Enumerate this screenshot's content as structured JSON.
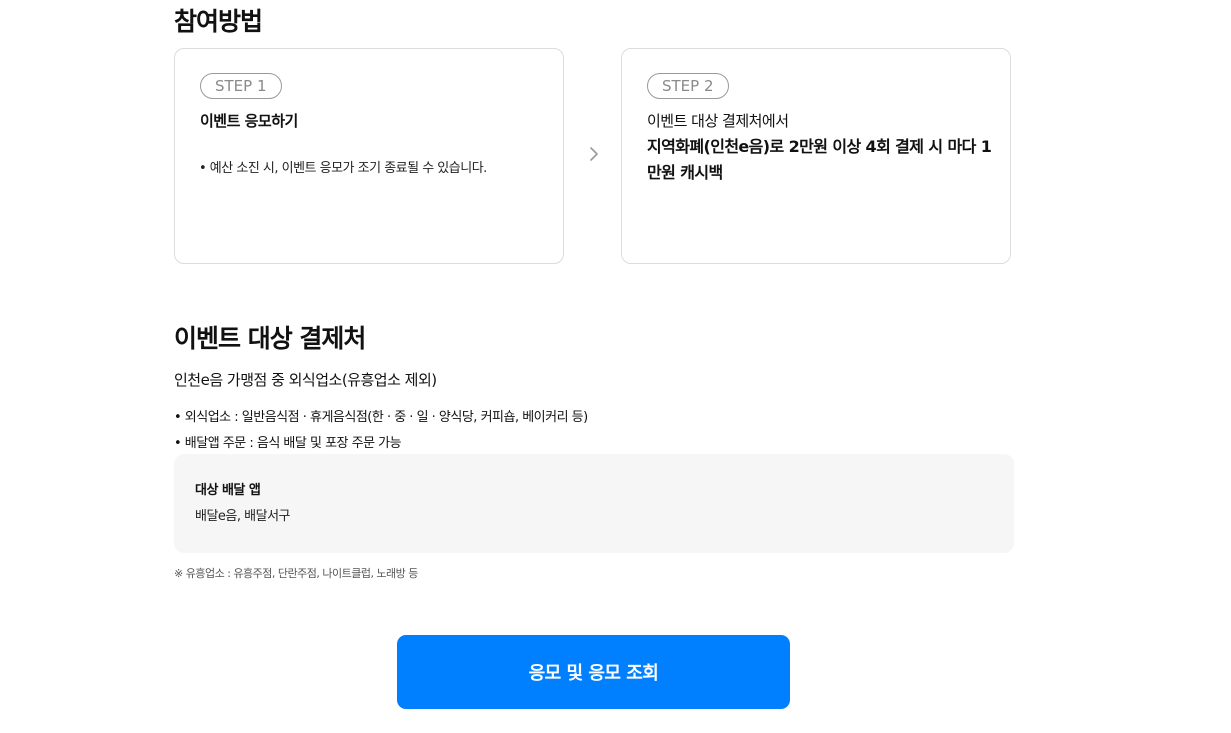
{
  "how_to": {
    "title": "참여방법",
    "steps": [
      {
        "badge": "STEP 1",
        "heading": "이벤트 응모하기",
        "note": "• 예산 소진 시, 이벤트 응모가 조기 종료될 수 있습니다."
      },
      {
        "badge": "STEP 2",
        "line1": "이벤트 대상 결제처에서",
        "line2": "지역화폐(인천e음)로 2만원 이상 4회 결제 시 마다 1만원 캐시백"
      }
    ],
    "arrow_icon": "chevron-right-icon"
  },
  "target": {
    "title": "이벤트 대상 결제처",
    "subtitle": "인천e음 가맹점 중 외식업소(유흥업소 제외)",
    "bullets": [
      "• 외식업소 : 일반음식점 · 휴게음식점(한 · 중 · 일 · 양식당, 커피숍, 베이커리 등)",
      "• 배달앱 주문 : 음식 배달 및 포장 주문 가능"
    ],
    "app_box": {
      "title": "대상 배달 앱",
      "apps": "배달e음, 배달서구"
    },
    "footnote": "※ 유흥업소 : 유흥주점, 단란주점, 나이트클럽, 노래방 등"
  },
  "cta": {
    "label": "응모 및 응모 조회",
    "color": "#0080ff"
  }
}
